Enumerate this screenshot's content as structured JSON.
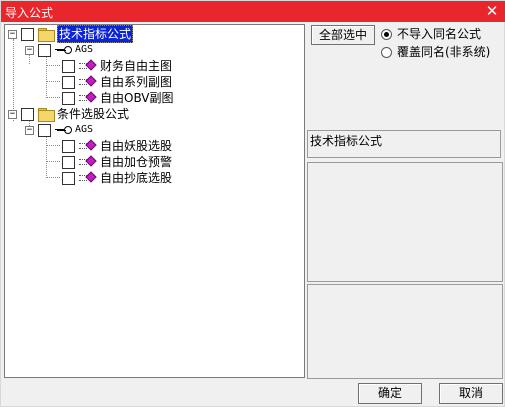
{
  "window": {
    "title": "导入公式",
    "close_glyph": "✕"
  },
  "tree": {
    "groups": [
      {
        "label": "技术指标公式",
        "expander": "−",
        "child": {
          "label": "AGS",
          "expander": "−",
          "items": [
            "财务自由主图",
            "自由系列副图",
            "自由OBV副图"
          ]
        }
      },
      {
        "label": "条件选股公式",
        "expander": "−",
        "child": {
          "label": "AGS",
          "expander": "−",
          "items": [
            "自由妖股选股",
            "自由加仓预警",
            "自由抄底选股"
          ]
        }
      }
    ]
  },
  "buttons": {
    "select_all": "全部选中",
    "ok": "确定",
    "cancel": "取消"
  },
  "options": [
    {
      "label": "不导入同名公式",
      "selected": true
    },
    {
      "label": "覆盖同名(非系统)",
      "selected": false
    }
  ],
  "info_panel": {
    "category": "技术指标公式"
  },
  "colors": {
    "titlebar": "#e8262b",
    "selection": "#0a24d6",
    "formula_icon": "#c21dc2"
  }
}
